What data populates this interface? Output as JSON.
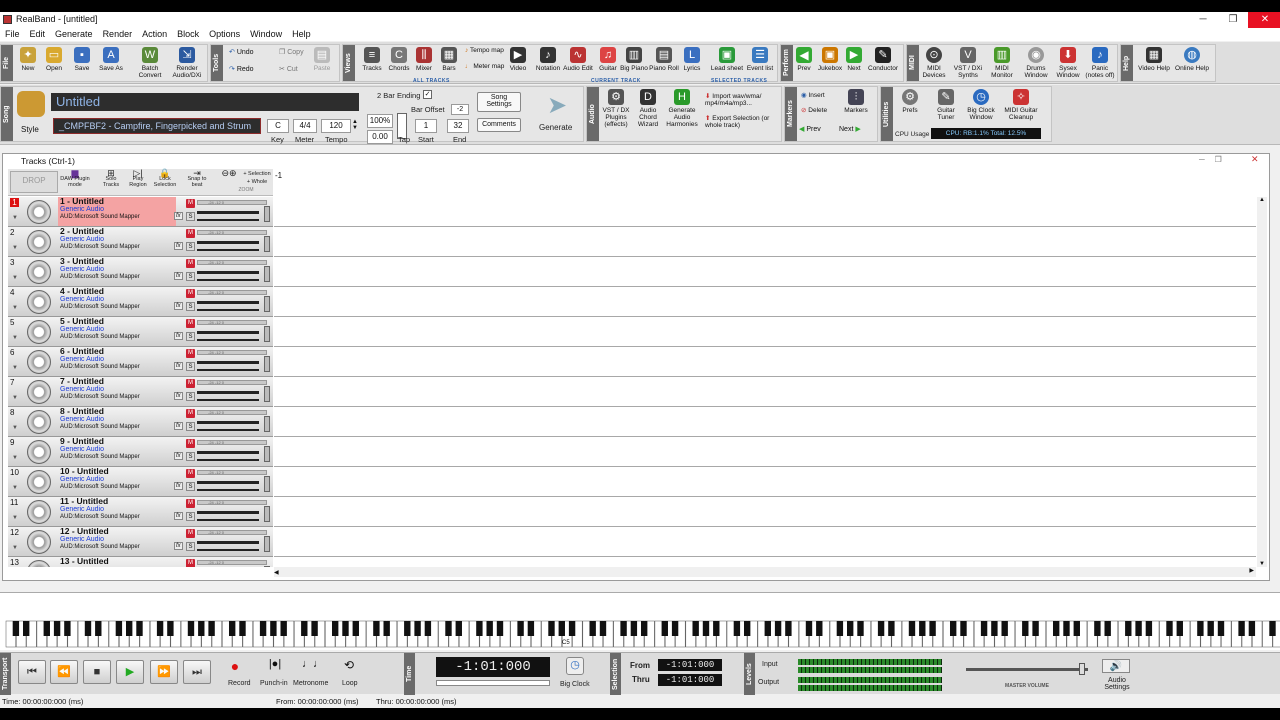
{
  "window": {
    "title": "RealBand - [untitled]",
    "min": "─",
    "max": "❐",
    "close": "✕"
  },
  "menu": [
    "File",
    "Edit",
    "Generate",
    "Render",
    "Action",
    "Block",
    "Options",
    "Window",
    "Help"
  ],
  "toolbar1": {
    "file": {
      "label": "File",
      "buttons": [
        "New",
        "Open",
        "Save",
        "Save As",
        "Batch Convert",
        "Render Audio/DXi"
      ]
    },
    "tools": {
      "label": "Tools",
      "undo": "Undo",
      "redo": "Redo",
      "copy": "Copy",
      "cut": "Cut",
      "paste": "Paste"
    },
    "views": {
      "label": "Views",
      "buttons": [
        "Tracks",
        "Chords",
        "Mixer",
        "Bars",
        "Tempo map",
        "Meter map",
        "Video"
      ],
      "sublabel": "ALL TRACKS"
    },
    "current": {
      "buttons": [
        "Notation",
        "Audio Edit",
        "Guitar",
        "Big Piano",
        "Piano Roll",
        "Lyrics"
      ],
      "sublabel": "CURRENT TRACK"
    },
    "selected": {
      "buttons": [
        "Lead sheet",
        "Event list"
      ],
      "sublabel": "SELECTED TRACKS"
    },
    "perform": {
      "label": "Perform",
      "buttons": [
        "Prev",
        "Jukebox",
        "Next",
        "Conductor"
      ]
    },
    "midi": {
      "label": "MIDI",
      "buttons": [
        "MIDI Devices",
        "VST / DXi Synths",
        "MIDI Monitor",
        "Drums Window",
        "Sysex Window",
        "Panic (notes off)"
      ]
    },
    "help": {
      "label": "Help",
      "buttons": [
        "Video Help",
        "Online Help"
      ]
    }
  },
  "toolbar2": {
    "song_label": "Song",
    "style_label": "Style",
    "song_title": "Untitled",
    "style_name": "_CMPFBF2 - Campfire, Fingerpicked and Strum",
    "key": "C",
    "key_label": "Key",
    "meter": "4/4",
    "meter_label": "Meter",
    "tempo": "120",
    "tempo_label": "Tempo",
    "bar_ending": "2 Bar Ending",
    "bar_offset_label": "Bar Offset",
    "bar_offset": "-2",
    "percent": "100%",
    "tap_value": "0.00",
    "tap_label": "Tap",
    "start": "1",
    "start_label": "Start",
    "end": "32",
    "end_label": "End",
    "song_settings": "Song Settings",
    "comments": "Comments",
    "generate": "Generate",
    "audio_label": "Audio",
    "audio_buttons": [
      "VST / DX Plugins (effects)",
      "Audio Chord Wizard",
      "Generate Audio Harmonies"
    ],
    "import": "Import wav/wma/ mp4/m4a/mp3...",
    "export": "Export Selection (or whole track)",
    "markers_label": "Markers",
    "insert": "Insert",
    "delete": "Delete",
    "markers": "Markers",
    "prev": "Prev",
    "next": "Next",
    "utilities_label": "Utilities",
    "util_buttons": [
      "Prefs",
      "Guitar Tuner",
      "Big Clock Window",
      "MIDI Guitar Cleanup"
    ],
    "cpu_label": "CPU Usage",
    "cpu_value": "CPU: RB:1.1% Total: 12.5%"
  },
  "tracks_window": {
    "title": "Tracks (Ctrl-1)",
    "header": [
      "DAW Plugin mode",
      "Solo Tracks",
      "Play Region",
      "Lock Selection",
      "Snap to beat"
    ],
    "drop_label": "DROP",
    "zoom_label": "ZOOM",
    "selection_label": "+ Selection",
    "whole_label": "+ Whole",
    "selection_value": "-1",
    "tracks": [
      {
        "num": "1",
        "name": "1 - Untitled",
        "type": "Generic Audio",
        "device": "AUD:Microsoft Sound Mapper"
      },
      {
        "num": "2",
        "name": "2 - Untitled",
        "type": "Generic Audio",
        "device": "AUD:Microsoft Sound Mapper"
      },
      {
        "num": "3",
        "name": "3 - Untitled",
        "type": "Generic Audio",
        "device": "AUD:Microsoft Sound Mapper"
      },
      {
        "num": "4",
        "name": "4 - Untitled",
        "type": "Generic Audio",
        "device": "AUD:Microsoft Sound Mapper"
      },
      {
        "num": "5",
        "name": "5 - Untitled",
        "type": "Generic Audio",
        "device": "AUD:Microsoft Sound Mapper"
      },
      {
        "num": "6",
        "name": "6 - Untitled",
        "type": "Generic Audio",
        "device": "AUD:Microsoft Sound Mapper"
      },
      {
        "num": "7",
        "name": "7 - Untitled",
        "type": "Generic Audio",
        "device": "AUD:Microsoft Sound Mapper"
      },
      {
        "num": "8",
        "name": "8 - Untitled",
        "type": "Generic Audio",
        "device": "AUD:Microsoft Sound Mapper"
      },
      {
        "num": "9",
        "name": "9 - Untitled",
        "type": "Generic Audio",
        "device": "AUD:Microsoft Sound Mapper"
      },
      {
        "num": "10",
        "name": "10 - Untitled",
        "type": "Generic Audio",
        "device": "AUD:Microsoft Sound Mapper"
      },
      {
        "num": "11",
        "name": "11 - Untitled",
        "type": "Generic Audio",
        "device": "AUD:Microsoft Sound Mapper"
      },
      {
        "num": "12",
        "name": "12 - Untitled",
        "type": "Generic Audio",
        "device": "AUD:Microsoft Sound Mapper"
      },
      {
        "num": "13",
        "name": "13 - Untitled",
        "type": "",
        "device": ""
      }
    ],
    "meter_ticks": "-24 -12 0",
    "m": "M",
    "s": "S",
    "fx": "fx"
  },
  "piano": {
    "c5_label": "C5"
  },
  "transport": {
    "label": "Transport",
    "record": "Record",
    "punch_in": "Punch-in",
    "metronome": "Metronome",
    "loop": "Loop",
    "time_label": "Time",
    "time_value": "-1:01:000",
    "big_clock": "Big Clock",
    "selection_label": "Selection",
    "from_label": "From",
    "from_value": "-1:01:000",
    "thru_label": "Thru",
    "thru_value": "-1:01:000",
    "levels_label": "Levels",
    "input_label": "Input",
    "output_label": "Output",
    "master_volume": "MASTER VOLUME",
    "audio_settings": "Audio Settings"
  },
  "status": {
    "time": "Time: 00:00:00:000 (ms)",
    "from": "From: 00:00:00:000 (ms)",
    "thru": "Thru: 00:00:00:000 (ms)"
  }
}
